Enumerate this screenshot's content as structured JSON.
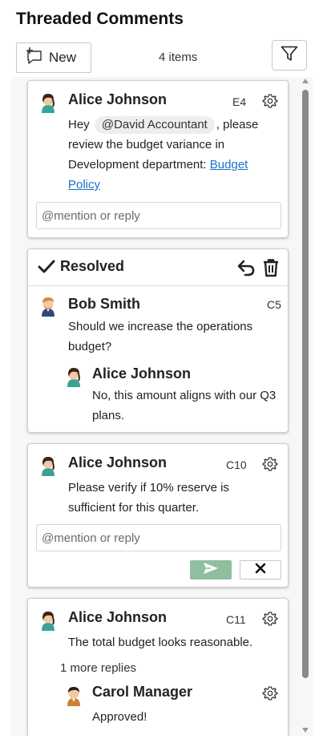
{
  "panel": {
    "title": "Threaded Comments",
    "new_label": "New",
    "items_count": "4 items"
  },
  "threads": [
    {
      "author": "Alice Johnson",
      "cell": "E4",
      "text_before": "Hey",
      "mention": "@David Accountant",
      "text_after": ", please review the budget variance in Development department:",
      "link": "Budget Policy",
      "reply_placeholder": "@mention or reply"
    },
    {
      "status": "Resolved",
      "author": "Bob Smith",
      "cell": "C5",
      "text": "Should we increase the operations budget?",
      "reply": {
        "author": "Alice Johnson",
        "text": "No, this amount aligns with our Q3 plans."
      }
    },
    {
      "author": "Alice Johnson",
      "cell": "C10",
      "text": "Please verify if 10% reserve is sufficient for this quarter.",
      "reply_placeholder": "@mention or reply"
    },
    {
      "author": "Alice Johnson",
      "cell": "C11",
      "text": "The total budget looks reasonable.",
      "more_replies": "1 more replies",
      "reply": {
        "author": "Carol Manager",
        "text": "Approved!"
      }
    }
  ],
  "colors": {
    "link": "#1a73c9",
    "send_button": "#8fbf9f",
    "scroll_thumb": "#8a8a8a"
  },
  "icons": {
    "new_comment": "new-comment-icon",
    "filter": "filter-icon",
    "settings": "gear-icon",
    "resolved": "checkmark-icon",
    "reopen": "undo-icon",
    "delete": "trash-icon",
    "send": "send-icon",
    "cancel": "close-icon"
  }
}
